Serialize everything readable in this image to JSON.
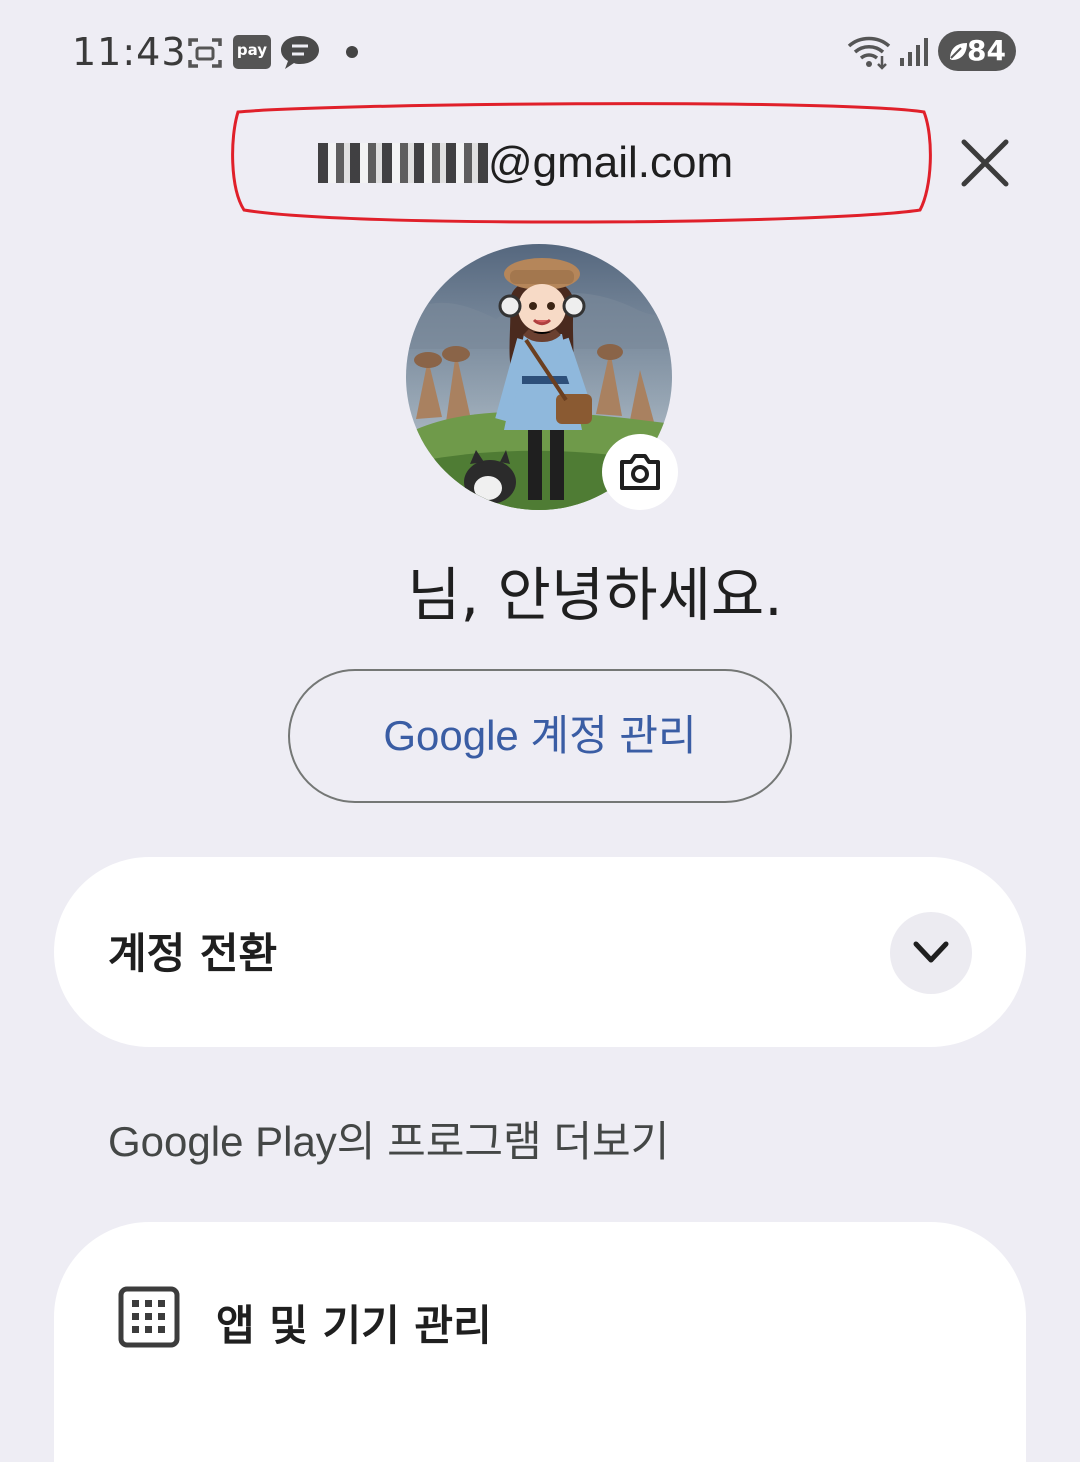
{
  "status_bar": {
    "time": "11:43",
    "pay_label": "pay",
    "battery_level": "84"
  },
  "account": {
    "email_visible": "@gmail.com",
    "email_masked_prefix": "q..in.k.2",
    "greeting": "님, 안녕하세요.",
    "manage_label": "Google 계정 관리"
  },
  "switch_account": {
    "label": "계정 전환"
  },
  "section": {
    "title": "Google Play의 프로그램 더보기"
  },
  "apps_devices": {
    "label": "앱 및 기기 관리"
  },
  "colors": {
    "accent": "#3a5da4",
    "highlight_outline": "#e0202a",
    "background": "#eeedf4"
  }
}
